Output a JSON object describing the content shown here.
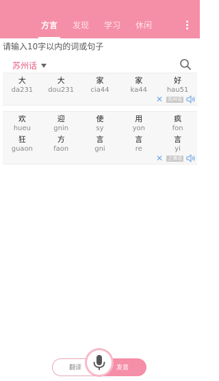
{
  "header": {
    "tabs": [
      {
        "label": "方言",
        "active": true
      },
      {
        "label": "发现",
        "active": false
      },
      {
        "label": "学习",
        "active": false
      },
      {
        "label": "休闲",
        "active": false
      }
    ],
    "more_icon": "vertical-dots-icon"
  },
  "input": {
    "placeholder": "请输入10字以内的词或句子"
  },
  "dialect": {
    "selected": "苏州话",
    "search_icon": "search-icon"
  },
  "results": [
    {
      "rows": [
        [
          {
            "char": "大",
            "pron": "da231"
          },
          {
            "char": "大",
            "pron": "dou231"
          },
          {
            "char": "家",
            "pron": "cia44"
          },
          {
            "char": "家",
            "pron": "ka44"
          },
          {
            "char": "好",
            "pron": "hau51"
          }
        ]
      ],
      "tag": "苏州话"
    },
    {
      "rows": [
        [
          {
            "char": "欢",
            "pron": "hueu"
          },
          {
            "char": "迎",
            "pron": "gnin"
          },
          {
            "char": "使",
            "pron": "sy"
          },
          {
            "char": "用",
            "pron": "yon"
          },
          {
            "char": "疯",
            "pron": "fon"
          }
        ],
        [
          {
            "char": "狂",
            "pron": "guaon"
          },
          {
            "char": "方",
            "pron": "faon"
          },
          {
            "char": "言",
            "pron": "gni"
          },
          {
            "char": "言",
            "pron": "re"
          },
          {
            "char": "言",
            "pron": "yi"
          }
        ]
      ],
      "tag": "上海话"
    }
  ],
  "bottom": {
    "translate_label": "翻译",
    "speak_label": "发音",
    "mic_icon": "microphone-icon"
  },
  "colors": {
    "primary": "#f58ea7",
    "dialect_text": "#e8587f",
    "action_blue": "#6aa6e6"
  }
}
